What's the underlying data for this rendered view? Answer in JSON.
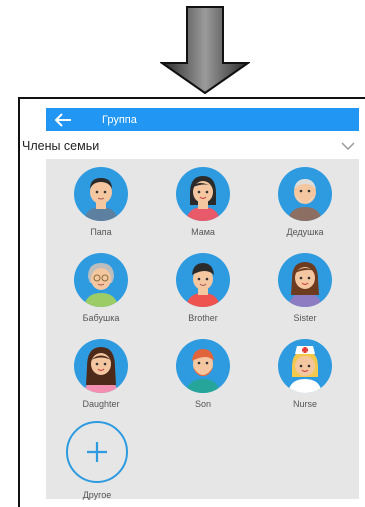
{
  "appbar": {
    "title": "Группа"
  },
  "selector": {
    "label": "Члены семьи"
  },
  "members": [
    {
      "label": "Папа"
    },
    {
      "label": "Мама"
    },
    {
      "label": "Дедушка"
    },
    {
      "label": "Бабушка"
    },
    {
      "label": "Brother"
    },
    {
      "label": "Sister"
    },
    {
      "label": "Daughter"
    },
    {
      "label": "Son"
    },
    {
      "label": "Nurse"
    }
  ],
  "add": {
    "label": "Другое"
  },
  "colors": {
    "accent": "#2196f3",
    "avatar_bg": "#2e9be0",
    "grid_bg": "#e6e6e6"
  }
}
